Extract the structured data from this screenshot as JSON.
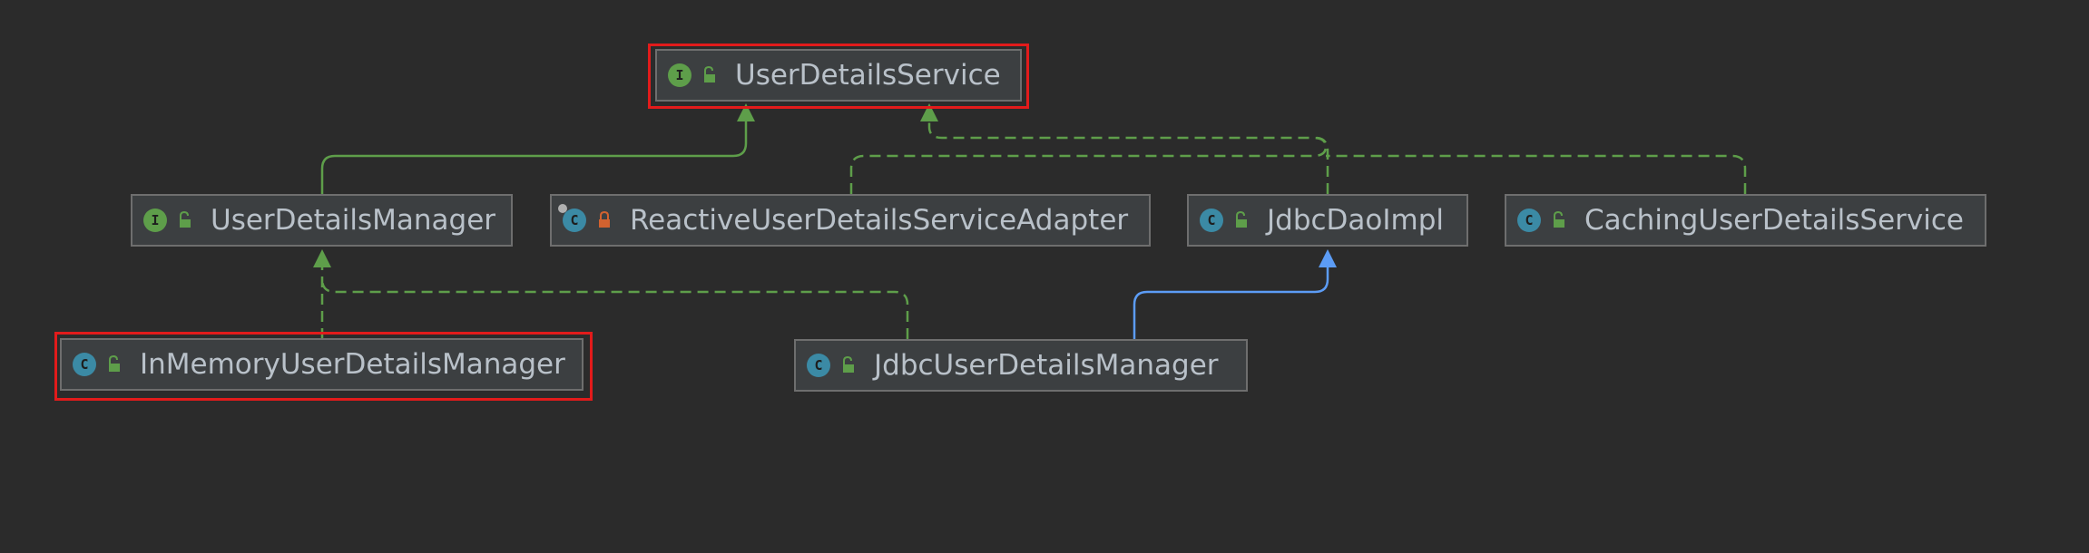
{
  "diagram": {
    "nodes": {
      "user_details_service": {
        "kind_letter": "I",
        "label": "UserDetailsService",
        "highlighted": true,
        "access": "public"
      },
      "user_details_manager": {
        "kind_letter": "I",
        "label": "UserDetailsManager",
        "highlighted": false,
        "access": "public"
      },
      "reactive_adapter": {
        "kind_letter": "C",
        "label": "ReactiveUserDetailsServiceAdapter",
        "highlighted": false,
        "access": "private"
      },
      "jdbc_dao_impl": {
        "kind_letter": "C",
        "label": "JdbcDaoImpl",
        "highlighted": false,
        "access": "public"
      },
      "caching_service": {
        "kind_letter": "C",
        "label": "CachingUserDetailsService",
        "highlighted": false,
        "access": "public"
      },
      "in_memory_manager": {
        "kind_letter": "C",
        "label": "InMemoryUserDetailsManager",
        "highlighted": true,
        "access": "public"
      },
      "jdbc_user_details_manager": {
        "kind_letter": "C",
        "label": "JdbcUserDetailsManager",
        "highlighted": false,
        "access": "public"
      }
    },
    "edges": [
      {
        "from": "user_details_manager",
        "to": "user_details_service",
        "type": "extends-interface",
        "style": "solid-green"
      },
      {
        "from": "reactive_adapter",
        "to": "user_details_service",
        "type": "implements",
        "style": "dashed-green"
      },
      {
        "from": "jdbc_dao_impl",
        "to": "user_details_service",
        "type": "implements",
        "style": "dashed-green"
      },
      {
        "from": "caching_service",
        "to": "user_details_service",
        "type": "implements",
        "style": "dashed-green"
      },
      {
        "from": "in_memory_manager",
        "to": "user_details_manager",
        "type": "implements",
        "style": "dashed-green"
      },
      {
        "from": "jdbc_user_details_manager",
        "to": "user_details_manager",
        "type": "implements",
        "style": "dashed-green"
      },
      {
        "from": "jdbc_user_details_manager",
        "to": "jdbc_dao_impl",
        "type": "extends-class",
        "style": "solid-blue"
      }
    ],
    "colors": {
      "background": "#2b2b2b",
      "node_fill": "#3c3f41",
      "node_border": "#6e6e6e",
      "highlight": "#e21b1b",
      "interface_badge": "#5e9e4a",
      "class_badge": "#3b8aa5",
      "implements_edge": "#5e9e4a",
      "extends_class_edge": "#5c9cf5",
      "public_lock": "#5e9e4a",
      "private_lock": "#d2622f"
    }
  }
}
